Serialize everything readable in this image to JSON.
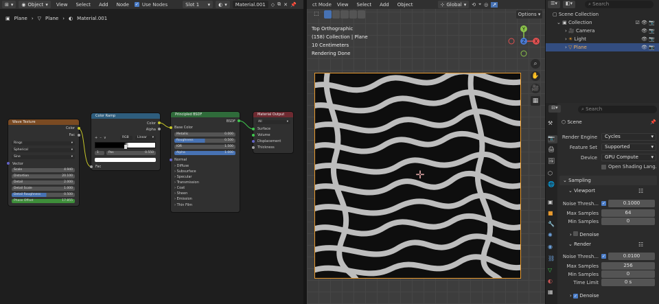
{
  "node_editor": {
    "header": {
      "mode": "Object",
      "menus": [
        "View",
        "Select",
        "Add",
        "Node"
      ],
      "use_nodes": "Use Nodes",
      "slot": "Slot 1",
      "material": "Material.001"
    },
    "breadcrumb": [
      "Plane",
      "Plane",
      "Material.001"
    ],
    "wave": {
      "title": "Wave Texture",
      "out_color": "Color",
      "out_fac": "Fac",
      "type": "Rings",
      "direction": "Spherical",
      "profile": "Sine",
      "vector": "Vector",
      "fields": [
        {
          "label": "Scale",
          "value": "4.940"
        },
        {
          "label": "Distortion",
          "value": "20.100"
        },
        {
          "label": "Detail",
          "value": "2.000"
        },
        {
          "label": "Detail Scale",
          "value": "1.000"
        },
        {
          "label": "Detail Roughness",
          "value": "0.500"
        },
        {
          "label": "Phase Offset",
          "value": "17.855"
        }
      ]
    },
    "ramp": {
      "title": "Color Ramp",
      "out_color": "Color",
      "out_alpha": "Alpha",
      "mode": "RGB",
      "interp": "Linear",
      "index": "1",
      "pos_label": "Pos",
      "pos_value": "0.550",
      "in_fac": "Fac"
    },
    "bsdf": {
      "title": "Principled BSDF",
      "out": "BSDF",
      "base_color": "Base Color",
      "fields": [
        {
          "label": "Metallic",
          "value": "0.000"
        },
        {
          "label": "Roughness",
          "value": "0.500"
        },
        {
          "label": "IOR",
          "value": "1.500"
        },
        {
          "label": "Alpha",
          "value": "1.000"
        }
      ],
      "normal": "Normal",
      "panels": [
        "Diffuse",
        "Subsurface",
        "Specular",
        "Transmission",
        "Coat",
        "Sheen",
        "Emission",
        "Thin Film"
      ]
    },
    "output": {
      "title": "Material Output",
      "target": "All",
      "sockets": [
        "Surface",
        "Volume",
        "Displacement",
        "Thickness"
      ]
    }
  },
  "viewport": {
    "header": {
      "mode": "ct Mode",
      "menus": [
        "View",
        "Select",
        "Add",
        "Object"
      ],
      "transform": "Global",
      "options": "Options"
    },
    "info": [
      "Top Orthographic",
      "(158) Collection | Plane",
      "10 Centimeters",
      "Rendering Done"
    ],
    "gizmo": {
      "z": "Z",
      "y": "Y",
      "x": "X"
    }
  },
  "outliner": {
    "search": "Search",
    "items": [
      "Scene Collection",
      "Collection",
      "Camera",
      "Light",
      "Plane"
    ]
  },
  "properties": {
    "search": "Search",
    "scene": "Scene",
    "render_engine_label": "Render Engine",
    "render_engine": "Cycles",
    "feature_set_label": "Feature Set",
    "feature_set": "Supported",
    "device_label": "Device",
    "device": "GPU Compute",
    "osl": "Open Shading Lang...",
    "sampling": "Sampling",
    "viewport": "Viewport",
    "vp_noise_label": "Noise Thresh...",
    "vp_noise": "0.1000",
    "vp_max_label": "Max Samples",
    "vp_max": "64",
    "vp_min_label": "Min Samples",
    "vp_min": "0",
    "denoise": "Denoise",
    "render": "Render",
    "r_noise_label": "Noise Thresh...",
    "r_noise": "0.0100",
    "r_max_label": "Max Samples",
    "r_max": "256",
    "r_min_label": "Min Samples",
    "r_min": "0",
    "time_limit_label": "Time Limit",
    "time_limit": "0 s",
    "denoise2": "Denoise"
  }
}
